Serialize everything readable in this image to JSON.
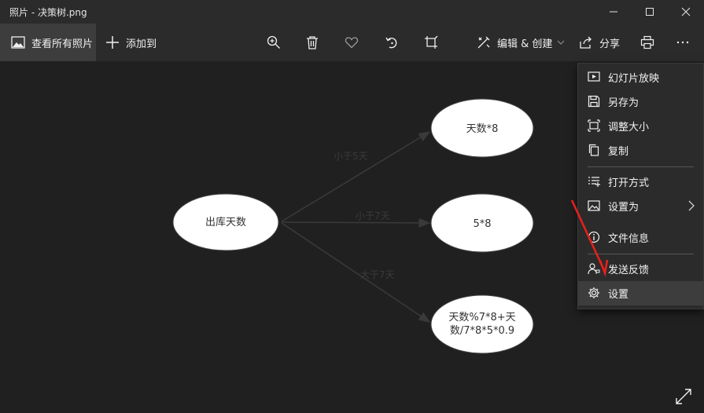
{
  "window": {
    "title": "照片 - 决策树.png"
  },
  "toolbar": {
    "view_all": "查看所有照片",
    "add_to": "添加到",
    "edit_create": "编辑 & 创建",
    "share": "分享"
  },
  "diagram": {
    "root": "出库天数",
    "leaf1": "天数*8",
    "leaf2": "5*8",
    "leaf3_line1": "天数%7*8+天",
    "leaf3_line2": "数/7*8*5*0.9",
    "edge1": "小于5天",
    "edge2": "小于7天",
    "edge3": "大于7天"
  },
  "menu": {
    "slideshow": "幻灯片放映",
    "save_as": "另存为",
    "resize": "调整大小",
    "copy": "复制",
    "open_with": "打开方式",
    "set_as": "设置为",
    "file_info": "文件信息",
    "feedback": "发送反馈",
    "settings": "设置"
  },
  "colors": {
    "accent_arrow": "#e8201c",
    "menu_bg": "#2b2b2b",
    "toolbar_bg": "#2b2b2b"
  }
}
